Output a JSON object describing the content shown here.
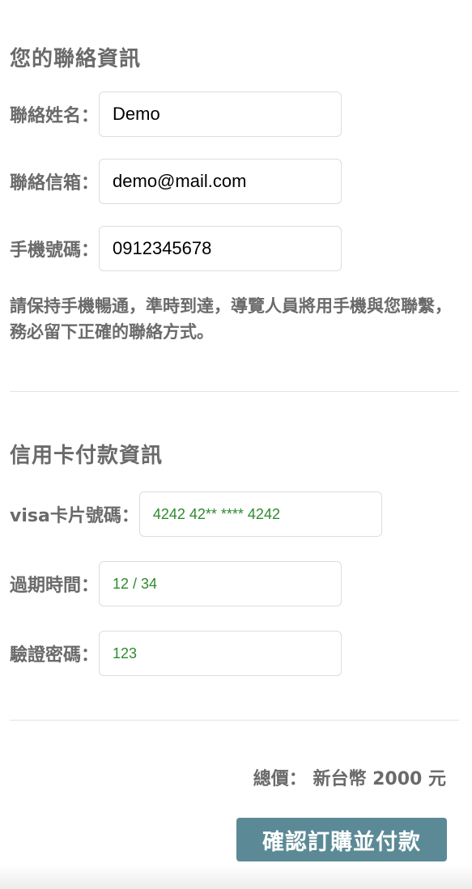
{
  "contact": {
    "title": "您的聯絡資訊",
    "name_label": "聯絡姓名：",
    "name_value": "Demo",
    "email_label": "聯絡信箱：",
    "email_value": "demo@mail.com",
    "phone_label": "手機號碼：",
    "phone_value": "0912345678",
    "note": "請保持手機暢通，準時到達，導覽人員將用手機與您聯繫，務必留下正確的聯絡方式。"
  },
  "payment": {
    "title": "信用卡付款資訊",
    "card_label": "visa卡片號碼：",
    "card_value": "4242 42** **** 4242",
    "expiry_label": "過期時間：",
    "expiry_value": "12 / 34",
    "cvc_label": "驗證密碼：",
    "cvc_value": "123"
  },
  "summary": {
    "total_text": "總價： 新台幣 2000 元"
  },
  "actions": {
    "submit_label": "確認訂購並付款"
  },
  "colors": {
    "accent": "#5b8a96",
    "card_text": "#2e8b2e",
    "label_text": "#6a6a6a"
  }
}
